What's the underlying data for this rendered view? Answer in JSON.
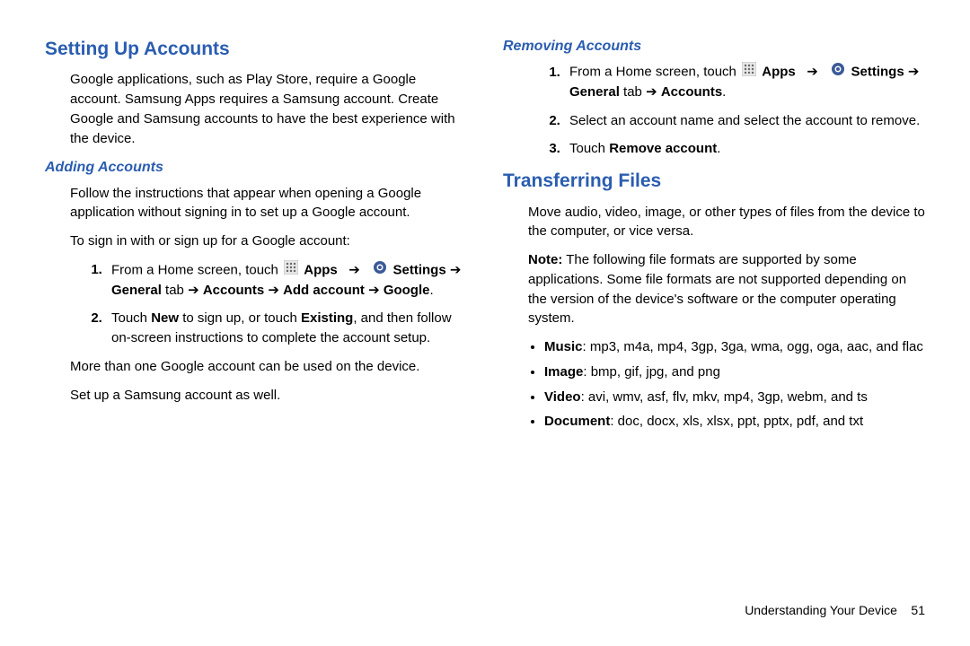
{
  "left": {
    "h1": "Setting Up Accounts",
    "p1": "Google applications, such as Play Store, require a Google account. Samsung Apps requires a Samsung account. Create Google and Samsung accounts to have the best experience with the device.",
    "sub1": "Adding Accounts",
    "p2": "Follow the instructions that appear when opening a Google application without signing in to set up a Google account.",
    "p3": "To sign in with or sign up for a Google account:",
    "step1_a": "From a Home screen, touch ",
    "step1_apps": "Apps",
    "step1_settings": "Settings",
    "step1_general": "General",
    "step1_tab": " tab ",
    "step1_accounts": "Accounts",
    "step1_add": "Add account",
    "step1_google": "Google",
    "step2_a": "Touch ",
    "step2_new": "New",
    "step2_b": " to sign up, or touch ",
    "step2_existing": "Existing",
    "step2_c": ", and then follow on-screen instructions to complete the account setup.",
    "p4": "More than one Google account can be used on the device.",
    "p5": "Set up a Samsung account as well."
  },
  "right": {
    "sub2": "Removing Accounts",
    "r1_a": "From a Home screen, touch ",
    "r1_apps": "Apps",
    "r1_settings": "Settings",
    "r1_general": "General",
    "r1_tab": " tab ",
    "r1_accounts": "Accounts",
    "r2": "Select an account name and select the account to remove.",
    "r3_a": "Touch ",
    "r3_b": "Remove account",
    "h2": "Transferring Files",
    "tp1": "Move audio, video, image, or other types of files from the device to the computer, or vice versa.",
    "tnote_label": "Note:",
    "tnote": " The following file formats are supported by some applications. Some file formats are not supported depending on the version of the device's software or the computer operating system.",
    "b_music": "Music",
    "b_music_v": ": mp3, m4a, mp4, 3gp, 3ga, wma, ogg, oga, aac, and flac",
    "b_image": "Image",
    "b_image_v": ": bmp, gif, jpg, and png",
    "b_video": "Video",
    "b_video_v": ": avi, wmv, asf, flv, mkv, mp4, 3gp, webm, and ts",
    "b_doc": "Document",
    "b_doc_v": ": doc, docx, xls, xlsx, ppt, pptx, pdf, and txt"
  },
  "footer": {
    "section": "Understanding Your Device",
    "page": "51"
  }
}
